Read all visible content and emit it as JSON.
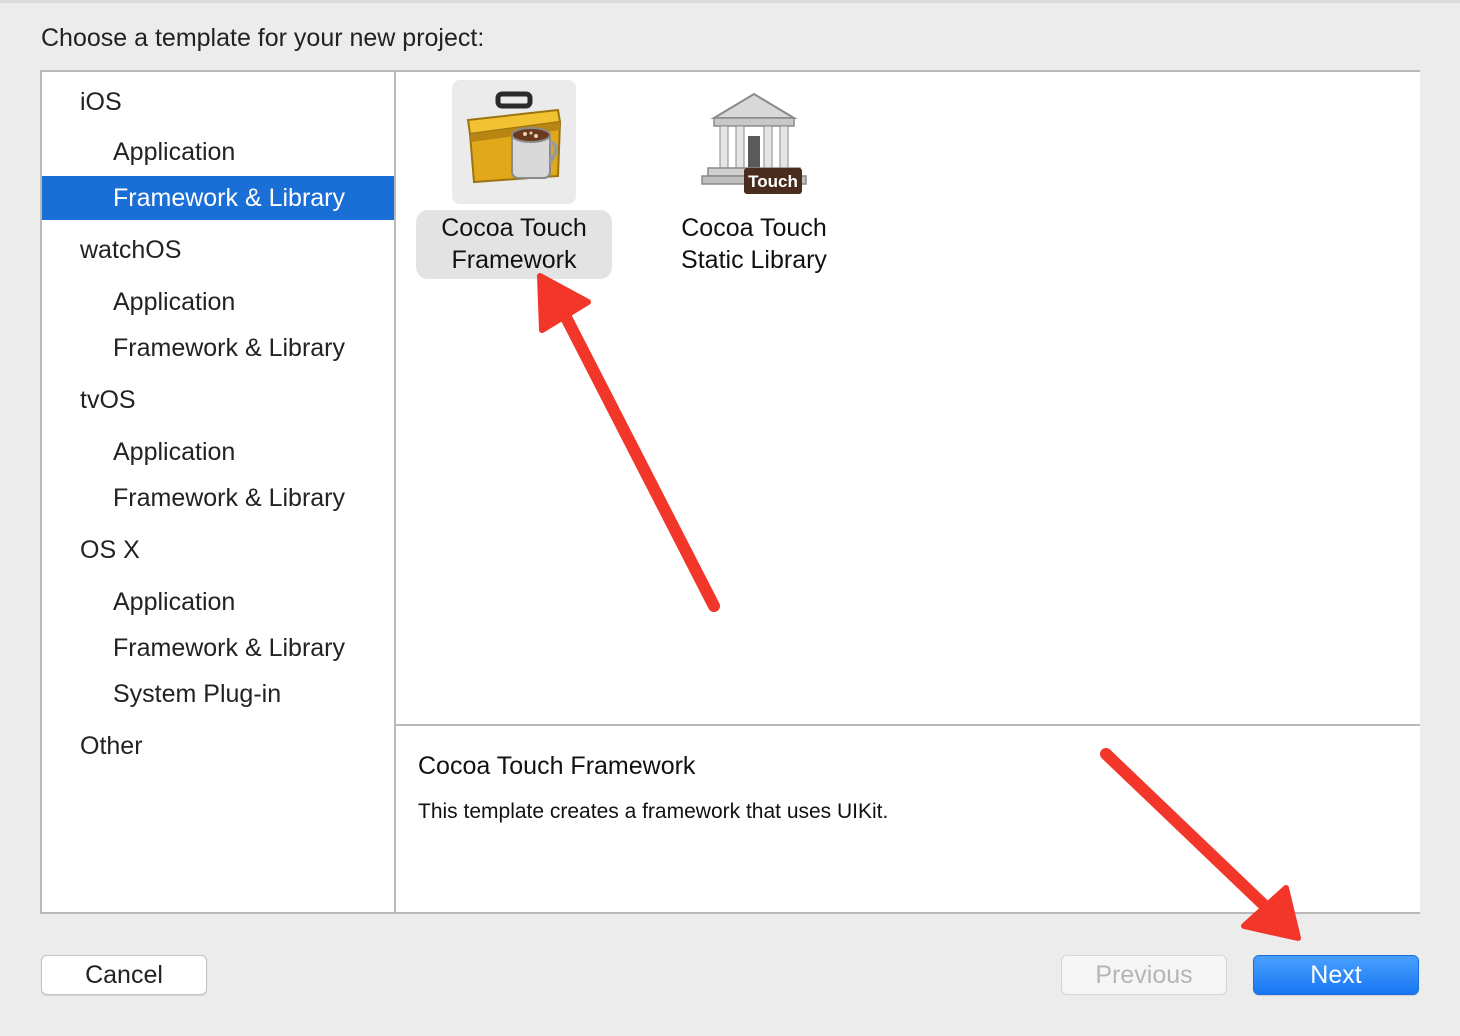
{
  "dialog": {
    "prompt": "Choose a template for your new project:"
  },
  "sidebar": {
    "items": [
      {
        "label": "iOS",
        "kind": "header"
      },
      {
        "label": "Application",
        "kind": "item"
      },
      {
        "label": "Framework & Library",
        "kind": "item",
        "selected": true
      },
      {
        "label": "watchOS",
        "kind": "header"
      },
      {
        "label": "Application",
        "kind": "item"
      },
      {
        "label": "Framework & Library",
        "kind": "item"
      },
      {
        "label": "tvOS",
        "kind": "header"
      },
      {
        "label": "Application",
        "kind": "item"
      },
      {
        "label": "Framework & Library",
        "kind": "item"
      },
      {
        "label": "OS X",
        "kind": "header"
      },
      {
        "label": "Application",
        "kind": "item"
      },
      {
        "label": "Framework & Library",
        "kind": "item"
      },
      {
        "label": "System Plug-in",
        "kind": "item"
      },
      {
        "label": "Other",
        "kind": "header"
      }
    ]
  },
  "templates": [
    {
      "line1": "Cocoa Touch",
      "line2": "Framework",
      "icon": "toolbox-icon",
      "selected": true
    },
    {
      "line1": "Cocoa Touch",
      "line2": "Static Library",
      "icon": "library-building-icon",
      "badge": "Touch",
      "selected": false
    }
  ],
  "description": {
    "title": "Cocoa Touch Framework",
    "text": "This template creates a framework that uses UIKit."
  },
  "buttons": {
    "cancel": "Cancel",
    "previous": "Previous",
    "next": "Next"
  },
  "colors": {
    "selection": "#1a6fd6",
    "primary_button": "#1877f2",
    "annotation_arrow": "#f2362a"
  }
}
